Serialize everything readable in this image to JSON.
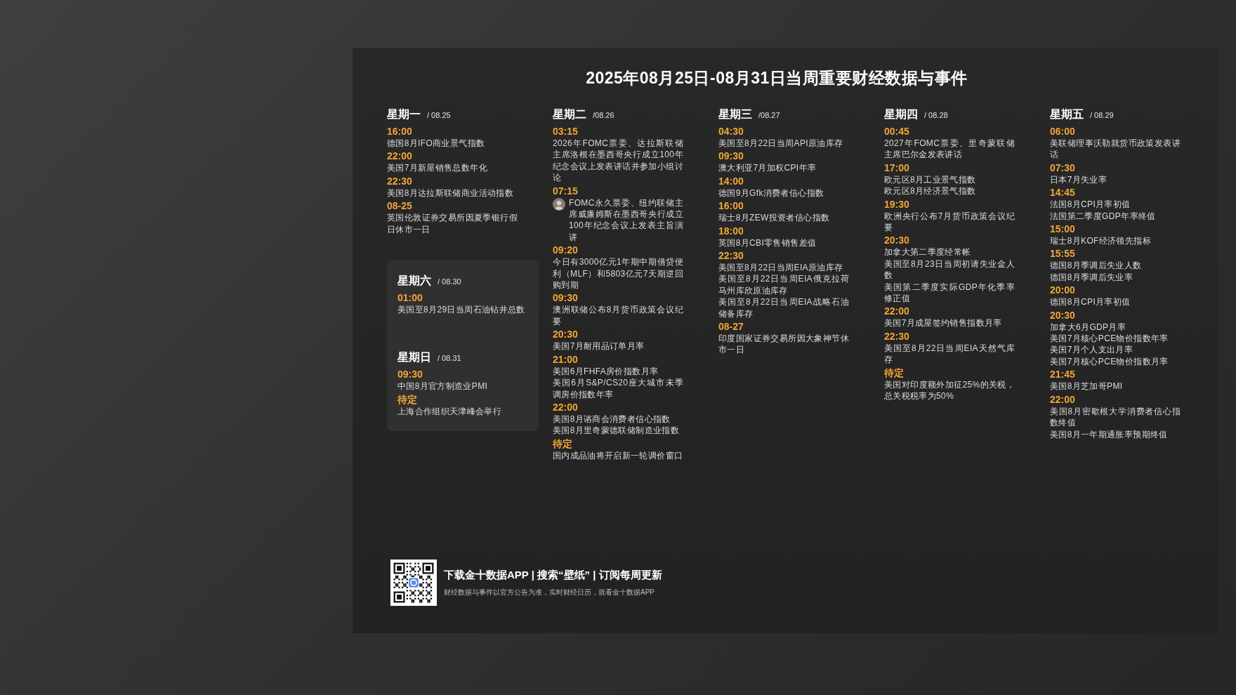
{
  "title": "2025年08月25日-08月31日当周重要财经数据与事件",
  "days": [
    {
      "name": "星期一",
      "date": "/ 08.25",
      "slots": [
        {
          "time": "16:00",
          "photo": false,
          "events": [
            "德国8月IFO商业景气指数"
          ]
        },
        {
          "time": "22:00",
          "photo": false,
          "events": [
            "美国7月新屋销售总数年化"
          ]
        },
        {
          "time": "22:30",
          "photo": false,
          "events": [
            "美国8月达拉斯联储商业活动指数"
          ]
        },
        {
          "time": "08-25",
          "photo": false,
          "events": [
            "英国伦敦证券交易所因夏季银行假日休市一日"
          ]
        }
      ]
    },
    {
      "name": "星期二",
      "date": "/08.26",
      "slots": [
        {
          "time": "03:15",
          "photo": false,
          "events": [
            "2026年FOMC票委、达拉斯联储主席洛根在墨西哥央行成立100年纪念会议上发表讲话并参加小组讨论"
          ]
        },
        {
          "time": "07:15",
          "photo": true,
          "events": [
            "FOMC永久票委、纽约联储主席威廉姆斯在墨西哥央行成立100年纪念会议上发表主旨演讲"
          ]
        },
        {
          "time": "09:20",
          "photo": false,
          "events": [
            "今日有3000亿元1年期中期借贷便利（MLF）和5803亿元7天期逆回购到期"
          ]
        },
        {
          "time": "09:30",
          "photo": false,
          "events": [
            "澳洲联储公布8月货币政策会议纪要"
          ]
        },
        {
          "time": "20:30",
          "photo": false,
          "events": [
            "美国7月耐用品订单月率"
          ]
        },
        {
          "time": "21:00",
          "photo": false,
          "events": [
            "美国6月FHFA房价指数月率",
            "美国6月S&P/CS20座大城市未季调房价指数年率"
          ]
        },
        {
          "time": "22:00",
          "photo": false,
          "events": [
            "美国8月谘商会消费者信心指数",
            "美国8月里奇蒙德联储制造业指数"
          ]
        },
        {
          "time": "待定",
          "photo": false,
          "events": [
            "国内成品油将开启新一轮调价窗口"
          ]
        }
      ]
    },
    {
      "name": "星期三",
      "date": "/08.27",
      "slots": [
        {
          "time": "04:30",
          "photo": false,
          "events": [
            "美国至8月22日当周API原油库存"
          ]
        },
        {
          "time": "09:30",
          "photo": false,
          "events": [
            "澳大利亚7月加权CPI年率"
          ]
        },
        {
          "time": "14:00",
          "photo": false,
          "events": [
            "德国9月Gfk消费者信心指数"
          ]
        },
        {
          "time": "16:00",
          "photo": false,
          "events": [
            "瑞士8月ZEW投资者信心指数"
          ]
        },
        {
          "time": "18:00",
          "photo": false,
          "events": [
            "英国8月CBI零售销售差值"
          ]
        },
        {
          "time": "22:30",
          "photo": false,
          "events": [
            "美国至8月22日当周EIA原油库存",
            "美国至8月22日当周EIA俄克拉荷马州库欣原油库存",
            "美国至8月22日当周EIA战略石油储备库存"
          ]
        },
        {
          "time": "08-27",
          "photo": false,
          "events": [
            "印度国家证券交易所因大象神节休市一日"
          ]
        }
      ]
    },
    {
      "name": "星期四",
      "date": "/ 08.28",
      "slots": [
        {
          "time": "00:45",
          "photo": false,
          "events": [
            "2027年FOMC票委、里奇蒙联储主席巴尔金发表讲话"
          ]
        },
        {
          "time": "17:00",
          "photo": false,
          "events": [
            "欧元区8月工业景气指数",
            "欧元区8月经济景气指数"
          ]
        },
        {
          "time": "19:30",
          "photo": false,
          "events": [
            "欧洲央行公布7月货币政策会议纪要"
          ]
        },
        {
          "time": "20:30",
          "photo": false,
          "events": [
            "加拿大第二季度经常帐",
            "美国至8月23日当周初请失业金人数",
            "美国第二季度实际GDP年化季率修正值"
          ]
        },
        {
          "time": "22:00",
          "photo": false,
          "events": [
            "美国7月成屋签约销售指数月率"
          ]
        },
        {
          "time": "22:30",
          "photo": false,
          "events": [
            "美国至8月22日当周EIA天然气库存"
          ]
        },
        {
          "time": "待定",
          "photo": false,
          "events": [
            "美国对印度额外加征25%的关税，总关税税率为50%"
          ]
        }
      ]
    },
    {
      "name": "星期五",
      "date": "/ 08.29",
      "slots": [
        {
          "time": "06:00",
          "photo": false,
          "events": [
            "美联储理事沃勒就货币政策发表讲话"
          ]
        },
        {
          "time": "07:30",
          "photo": false,
          "events": [
            "日本7月失业率"
          ]
        },
        {
          "time": "14:45",
          "photo": false,
          "events": [
            "法国8月CPI月率初值",
            "法国第二季度GDP年率终值"
          ]
        },
        {
          "time": "15:00",
          "photo": false,
          "events": [
            "瑞士8月KOF经济领先指标"
          ]
        },
        {
          "time": "15:55",
          "photo": false,
          "events": [
            "德国8月季调后失业人数",
            "德国8月季调后失业率"
          ]
        },
        {
          "time": "20:00",
          "photo": false,
          "events": [
            "德国8月CPI月率初值"
          ]
        },
        {
          "time": "20:30",
          "photo": false,
          "events": [
            "加拿大6月GDP月率",
            "美国7月核心PCE物价指数年率",
            "美国7月个人支出月率",
            "美国7月核心PCE物价指数月率"
          ]
        },
        {
          "time": "21:45",
          "photo": false,
          "events": [
            "美国8月芝加哥PMI"
          ]
        },
        {
          "time": "22:00",
          "photo": false,
          "events": [
            "美国8月密歇根大学消费者信心指数终值",
            "美国8月一年期通胀率预期终值"
          ]
        }
      ]
    }
  ],
  "weekend": [
    {
      "name": "星期六",
      "date": "/ 08.30",
      "slots": [
        {
          "time": "01:00",
          "photo": false,
          "events": [
            "美国至8月29日当周石油钻井总数"
          ]
        }
      ]
    },
    {
      "name": "星期日",
      "date": "/ 08.31",
      "slots": [
        {
          "time": "09:30",
          "photo": false,
          "events": [
            "中国8月官方制造业PMI"
          ]
        },
        {
          "time": "待定",
          "photo": false,
          "events": [
            "上海合作组织天津峰会举行"
          ]
        }
      ]
    }
  ],
  "footer": {
    "headline": "下载金十数据APP | 搜索“壁纸” | 订阅每周更新",
    "note": "财经数据与事件以官方公告为准，实时财经日历，就看金十数据APP"
  }
}
